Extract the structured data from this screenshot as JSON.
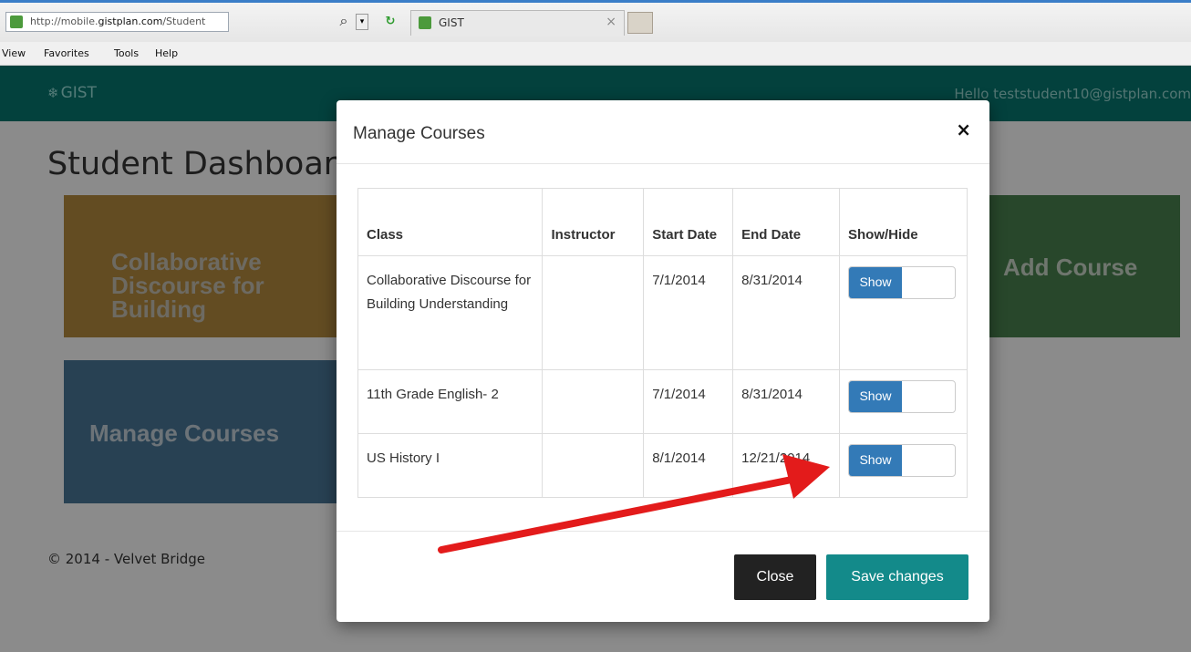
{
  "browser": {
    "address_prefix": "http://mobile.",
    "address_host": "gistplan.com",
    "address_path": "/Student",
    "tab_title": "GIST",
    "menu": [
      "View",
      "Favorites",
      "Tools",
      "Help"
    ]
  },
  "app": {
    "brand": "GIST",
    "greeting": "Hello teststudent10@gistplan.com",
    "page_title": "Student Dashboard",
    "tiles": {
      "collab": "Collaborative Discourse for Building",
      "manage": "Manage Courses",
      "add": "Add Course"
    },
    "footer": "© 2014 - Velvet Bridge"
  },
  "modal": {
    "title": "Manage Courses",
    "close_icon": "×",
    "headers": [
      "Class",
      "Instructor",
      "Start Date",
      "End Date",
      "Show/Hide"
    ],
    "rows": [
      {
        "class": "Collaborative Discourse for Building Understanding",
        "instructor": "",
        "start": "7/1/2014",
        "end": "8/31/2014",
        "toggle": "Show"
      },
      {
        "class": "11th Grade English- 2",
        "instructor": "",
        "start": "7/1/2014",
        "end": "8/31/2014",
        "toggle": "Show"
      },
      {
        "class": "US History I",
        "instructor": "",
        "start": "8/1/2014",
        "end": "12/21/2014",
        "toggle": "Show"
      }
    ],
    "buttons": {
      "close": "Close",
      "save": "Save changes"
    }
  },
  "colors": {
    "navbar": "#05615c",
    "primary": "#337ab7",
    "save": "#138a8a",
    "arrow": "#e31b1b"
  }
}
